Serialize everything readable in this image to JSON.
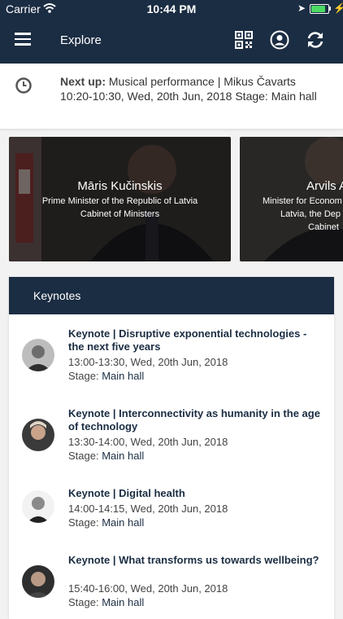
{
  "status_bar": {
    "carrier": "Carrier",
    "time": "10:44 PM",
    "battery_level": 0.85,
    "battery_color": "#4cd964"
  },
  "nav": {
    "title": "Explore",
    "menu_icon": "hamburger-menu-icon",
    "icons": [
      "qr-code-icon",
      "user-profile-icon",
      "sync-icon"
    ]
  },
  "next_up": {
    "label": "Next up:",
    "title": "Musical performance | Mikus Čavarts",
    "details": "10:20-10:30, Wed, 20th Jun, 2018 Stage: Main hall"
  },
  "speakers": [
    {
      "name": "Māris Kučinskis",
      "role_line1": "Prime Minister of the Republic of Latvia",
      "role_line2": "Cabinet of Ministers"
    },
    {
      "name": "Arvils A",
      "role_line1": "Minister for Econom",
      "role_line2": "Latvia, the Dep",
      "role_line3": "Cabinet"
    }
  ],
  "keynotes": {
    "header": "Keynotes",
    "sessions": [
      {
        "title": "Keynote | Disruptive exponential technologies - the next five years",
        "time": "13:00-13:30, Wed, 20th Jun, 2018",
        "stage_label": "Stage:",
        "stage": "Main hall"
      },
      {
        "title": "Keynote | Interconnectivity as humanity in the age of technology",
        "time": "13:30-14:00, Wed, 20th Jun, 2018",
        "stage_label": "Stage:",
        "stage": "Main hall"
      },
      {
        "title": "Keynote | Digital health",
        "time": "14:00-14:15, Wed, 20th Jun, 2018",
        "stage_label": "Stage:",
        "stage": "Main hall"
      },
      {
        "title": "Keynote | What transforms us towards wellbeing?",
        "time": "15:40-16:00, Wed, 20th Jun, 2018",
        "stage_label": "Stage:",
        "stage": "Main hall"
      }
    ]
  },
  "colors": {
    "primary": "#1b2d43",
    "background": "#f2f2f2"
  }
}
